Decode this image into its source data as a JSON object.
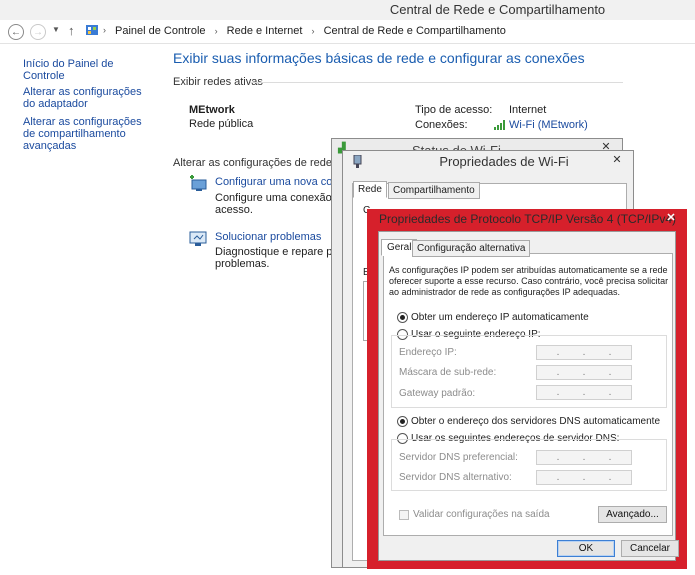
{
  "window": {
    "title": "Central de Rede e Compartilhamento"
  },
  "address": {
    "crumbs": [
      "Painel de Controle",
      "Rede e Internet",
      "Central de Rede e Compartilhamento"
    ]
  },
  "sidebar": {
    "items": [
      {
        "label": "Início do Painel de Controle"
      },
      {
        "label": "Alterar as configurações do adaptador"
      },
      {
        "label": "Alterar as configurações de compartilhamento avançadas"
      }
    ]
  },
  "main": {
    "title": "Exibir suas informações básicas de rede e configurar as conexões",
    "active_networks_label": "Exibir redes ativas",
    "network_name": "MEtwork",
    "network_type": "Rede pública",
    "access_type_label": "Tipo de acesso:",
    "access_type_value": "Internet",
    "connections_label": "Conexões:",
    "connections_value": "Wi-Fi (MEtwork)",
    "change_settings_label": "Alterar as configurações de rede",
    "tasks": [
      {
        "title": "Configurar uma nova conex",
        "desc1": "Configure uma conexão de",
        "desc2": "acesso."
      },
      {
        "title": "Solucionar problemas",
        "desc1": "Diagnostique e repare probl",
        "desc2": "problemas."
      }
    ]
  },
  "wifi_status": {
    "title": "Status de Wi-Fi"
  },
  "wifi_props": {
    "title": "Propriedades de Wi-Fi",
    "tabs": [
      "Rede",
      "Compartilhamento"
    ],
    "partial1": "C",
    "partial2": "E"
  },
  "tcpip": {
    "title": "Propriedades de Protocolo TCP/IP Versão 4 (TCP/IPv4)",
    "tabs": [
      "Geral",
      "Configuração alternativa"
    ],
    "description": "As configurações IP podem ser atribuídas automaticamente se a rede oferecer suporte a esse recurso. Caso contrário, você precisa solicitar ao administrador de rede as configurações IP adequadas.",
    "ip_auto": "Obter um endereço IP automaticamente",
    "ip_manual": "Usar o seguinte endereço IP:",
    "ip_fields": [
      "Endereço IP:",
      "Máscara de sub-rede:",
      "Gateway padrão:"
    ],
    "dns_auto": "Obter o endereço dos servidores DNS automaticamente",
    "dns_manual": "Usar os seguintes endereços de servidor DNS:",
    "dns_fields": [
      "Servidor DNS preferencial:",
      "Servidor DNS alternativo:"
    ],
    "validate": "Validar configurações na saída",
    "advanced": "Avançado...",
    "ok": "OK",
    "cancel": "Cancelar",
    "highlight_color": "#d6202b"
  }
}
